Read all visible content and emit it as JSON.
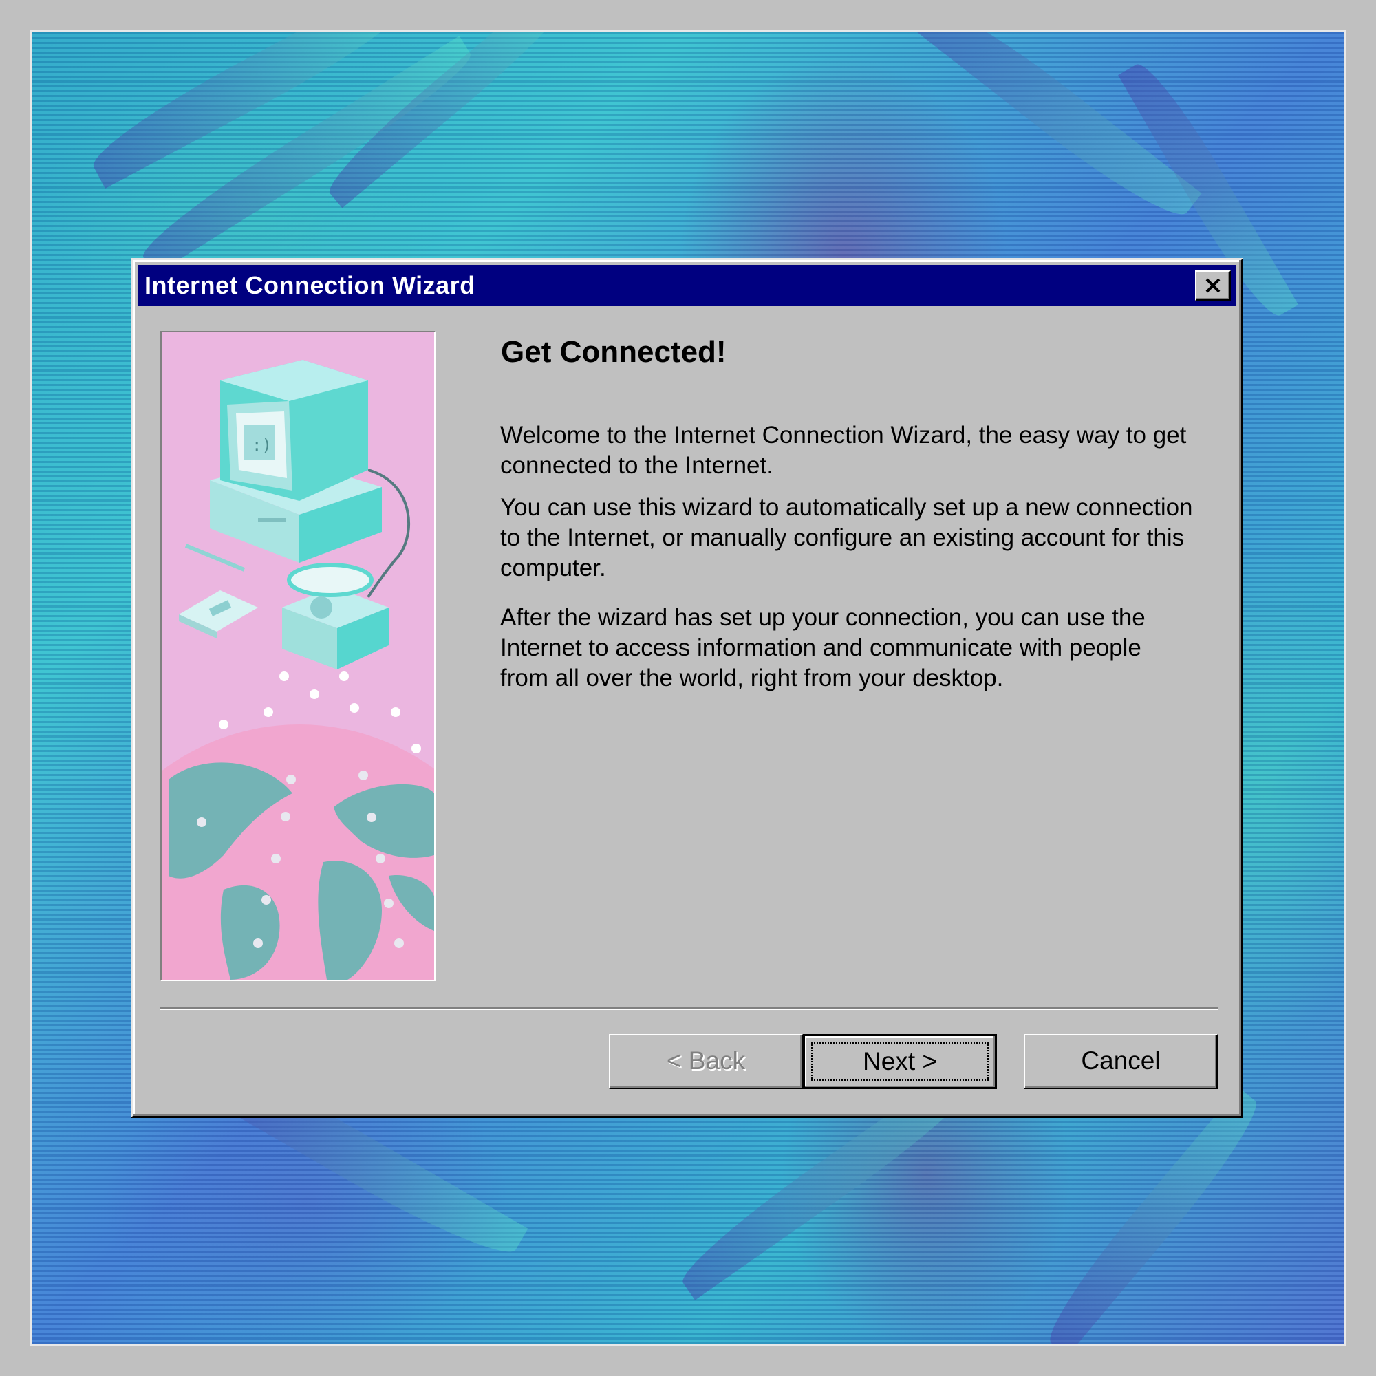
{
  "dialog": {
    "title": "Internet Connection Wizard",
    "close_icon": "close-x-icon",
    "heading": "Get Connected!",
    "paragraphs": [
      "Welcome to the Internet Connection Wizard, the easy way to get connected to the Internet.",
      "You can use this wizard to automatically set up a new connection to the Internet, or manually configure an existing account for this computer.",
      "After the wizard has set up your connection, you can use the Internet to access information and communicate with people from all over the world, right from your desktop."
    ],
    "buttons": {
      "back": "< Back",
      "next": "Next >",
      "cancel": "Cancel"
    },
    "back_enabled": false,
    "default_button": "next",
    "illustration": "computer-phone-globe-illustration"
  },
  "colors": {
    "titlebar": "#000080",
    "dialog_face": "#c0c0c0",
    "illustration_bg": "#ebb6e0",
    "illustration_accent": "#5ed8d0"
  }
}
